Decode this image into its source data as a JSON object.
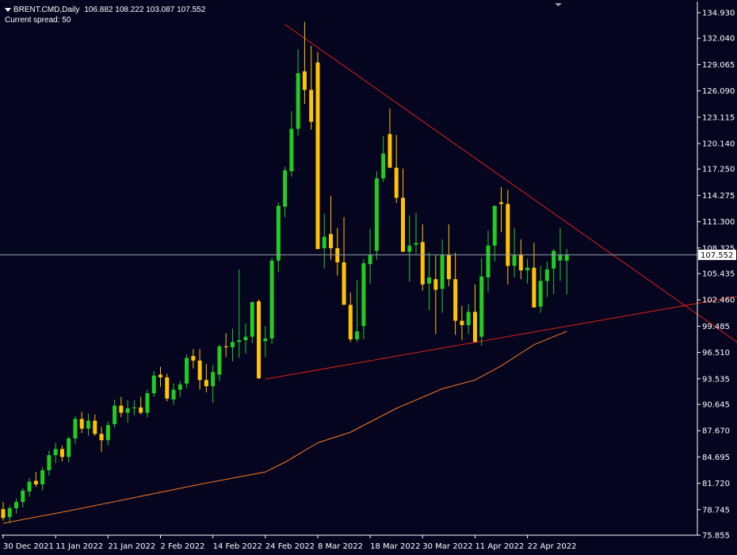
{
  "header": {
    "symbol": "BRENT.CMD,Daily",
    "ohlc": "106.882 108.222 103.087 107.552",
    "spread": "Current spread: 50"
  },
  "colors": {
    "background": "#050520",
    "axis": "#ffffff",
    "bull": "#22cc22",
    "bear": "#ffc400",
    "trendline": "#dd2211",
    "moving_average": "#ff7a1a",
    "price_line": "#9aa0b0",
    "price_tag_bg": "#ffffff",
    "price_tag_text": "#000000"
  },
  "chart_data": {
    "type": "candlestick",
    "title": "",
    "ylim": [
      75.855,
      134.93
    ],
    "y_ticks": [
      "134.930",
      "132.040",
      "129.065",
      "126.090",
      "123.115",
      "120.140",
      "117.250",
      "114.275",
      "111.300",
      "108.325",
      "105.435",
      "102.460",
      "99.485",
      "96.510",
      "93.535",
      "90.645",
      "87.670",
      "84.695",
      "81.720",
      "78.745",
      "75.855"
    ],
    "x_labels": [
      {
        "label": "30 Dec 2021",
        "i": 0
      },
      {
        "label": "11 Jan 2022",
        "i": 8
      },
      {
        "label": "21 Jan 2022",
        "i": 16
      },
      {
        "label": "2 Feb 2022",
        "i": 24
      },
      {
        "label": "14 Feb 2022",
        "i": 32
      },
      {
        "label": "24 Feb 2022",
        "i": 40
      },
      {
        "label": "8 Mar 2022",
        "i": 48
      },
      {
        "label": "18 Mar 2022",
        "i": 56
      },
      {
        "label": "30 Mar 2022",
        "i": 64
      },
      {
        "label": "11 Apr 2022",
        "i": 72
      },
      {
        "label": "22 Apr 2022",
        "i": 80
      }
    ],
    "current_price": 107.552,
    "current_price_label": "107.552",
    "candles": [
      [
        78.8,
        79.6,
        77.5,
        77.8
      ],
      [
        77.9,
        79.2,
        77.2,
        78.9
      ],
      [
        78.9,
        80.0,
        78.3,
        79.6
      ],
      [
        79.6,
        81.2,
        79.0,
        80.9
      ],
      [
        80.8,
        82.3,
        80.2,
        81.9
      ],
      [
        82.0,
        83.0,
        81.3,
        81.6
      ],
      [
        81.6,
        83.6,
        80.9,
        83.2
      ],
      [
        83.2,
        85.4,
        82.6,
        84.9
      ],
      [
        84.9,
        86.3,
        84.0,
        85.6
      ],
      [
        85.6,
        86.0,
        84.2,
        84.7
      ],
      [
        84.7,
        87.0,
        84.1,
        86.8
      ],
      [
        86.8,
        89.3,
        86.2,
        89.0
      ],
      [
        89.0,
        89.8,
        87.4,
        87.9
      ],
      [
        87.9,
        89.6,
        87.1,
        88.8
      ],
      [
        88.8,
        89.5,
        87.1,
        87.3
      ],
      [
        87.3,
        88.1,
        85.3,
        86.6
      ],
      [
        86.6,
        88.7,
        86.0,
        88.3
      ],
      [
        88.4,
        91.2,
        88.0,
        90.5
      ],
      [
        90.5,
        91.5,
        89.2,
        89.7
      ],
      [
        89.7,
        91.1,
        88.6,
        90.2
      ],
      [
        90.2,
        91.1,
        89.4,
        90.3
      ],
      [
        90.3,
        91.5,
        89.5,
        89.7
      ],
      [
        89.7,
        92.3,
        89.2,
        91.9
      ],
      [
        91.9,
        94.4,
        91.5,
        93.9
      ],
      [
        94.0,
        94.9,
        92.6,
        93.7
      ],
      [
        93.7,
        94.1,
        91.0,
        91.3
      ],
      [
        91.2,
        93.0,
        90.6,
        92.3
      ],
      [
        92.3,
        93.3,
        91.5,
        92.9
      ],
      [
        93.0,
        96.3,
        92.5,
        95.9
      ],
      [
        96.1,
        96.9,
        94.7,
        95.6
      ],
      [
        95.6,
        96.9,
        92.3,
        93.4
      ],
      [
        93.4,
        95.2,
        92.0,
        92.7
      ],
      [
        92.7,
        95.1,
        90.8,
        94.3
      ],
      [
        94.0,
        97.4,
        93.3,
        97.2
      ],
      [
        97.2,
        98.7,
        96.0,
        97.1
      ],
      [
        97.1,
        99.2,
        95.5,
        97.7
      ],
      [
        97.7,
        105.9,
        95.9,
        97.9
      ],
      [
        97.9,
        99.8,
        96.4,
        98.3
      ],
      [
        98.3,
        102.3,
        97.6,
        102.2
      ],
      [
        102.3,
        102.5,
        93.5,
        93.6
      ],
      [
        97.8,
        99.5,
        96.0,
        98.1
      ],
      [
        98.1,
        107.2,
        97.5,
        106.9
      ],
      [
        106.9,
        113.5,
        105.6,
        113.1
      ],
      [
        113.0,
        117.5,
        111.8,
        117.1
      ],
      [
        117.0,
        123.8,
        116.4,
        121.8
      ],
      [
        121.8,
        130.8,
        121.0,
        128.1
      ],
      [
        128.3,
        133.9,
        124.6,
        126.2
      ],
      [
        126.2,
        131.2,
        121.7,
        122.6
      ],
      [
        129.3,
        130.5,
        108.3,
        108.2
      ],
      [
        108.3,
        112.2,
        106.0,
        109.6
      ],
      [
        109.9,
        114.2,
        107.0,
        108.3
      ],
      [
        108.3,
        110.6,
        105.2,
        106.7
      ],
      [
        106.7,
        111.8,
        101.9,
        101.9
      ],
      [
        101.9,
        103.3,
        97.7,
        98.0
      ],
      [
        98.0,
        104.7,
        97.7,
        98.9
      ],
      [
        99.5,
        107.1,
        98.0,
        106.6
      ],
      [
        106.5,
        110.5,
        104.3,
        107.5
      ],
      [
        108.0,
        117.0,
        107.0,
        116.2
      ],
      [
        116.2,
        121.0,
        115.8,
        119.0
      ],
      [
        121.2,
        124.1,
        117.7,
        117.4
      ],
      [
        117.4,
        121.1,
        113.4,
        114.0
      ],
      [
        114.0,
        117.3,
        109.0,
        107.9
      ],
      [
        107.9,
        112.0,
        104.5,
        108.6
      ],
      [
        108.7,
        112.3,
        107.7,
        108.9
      ],
      [
        109.0,
        111.0,
        103.5,
        104.2
      ],
      [
        104.3,
        107.8,
        101.3,
        105.0
      ],
      [
        104.8,
        107.5,
        98.6,
        103.6
      ],
      [
        103.7,
        109.3,
        101.0,
        107.5
      ],
      [
        107.5,
        111.0,
        104.0,
        104.8
      ],
      [
        104.8,
        107.8,
        98.5,
        100.1
      ],
      [
        100.1,
        101.8,
        97.9,
        99.6
      ],
      [
        99.6,
        102.0,
        98.6,
        101.1
      ],
      [
        101.1,
        104.2,
        98.2,
        97.7
      ],
      [
        98.3,
        107.2,
        97.3,
        105.1
      ],
      [
        105.0,
        110.3,
        103.3,
        108.6
      ],
      [
        108.6,
        111.8,
        106.8,
        113.1
      ],
      [
        113.5,
        115.2,
        110.1,
        113.3
      ],
      [
        113.3,
        114.9,
        104.2,
        106.3
      ],
      [
        106.3,
        110.6,
        105.0,
        107.5
      ],
      [
        107.6,
        109.3,
        104.8,
        105.8
      ],
      [
        105.8,
        107.1,
        104.3,
        106.1
      ],
      [
        106.1,
        108.9,
        101.9,
        101.6
      ],
      [
        101.7,
        106.3,
        101.0,
        104.6
      ],
      [
        104.6,
        106.8,
        102.8,
        105.9
      ],
      [
        106.0,
        108.2,
        103.1,
        108.0
      ],
      [
        106.9,
        110.6,
        104.6,
        107.5
      ],
      [
        106.882,
        108.222,
        103.087,
        107.552
      ]
    ],
    "moving_average": [
      [
        0,
        77.2
      ],
      [
        10,
        78.6
      ],
      [
        20,
        80.1
      ],
      [
        30,
        81.6
      ],
      [
        40,
        83.0
      ],
      [
        43,
        84.1
      ],
      [
        48,
        86.3
      ],
      [
        53,
        87.5
      ],
      [
        60,
        90.2
      ],
      [
        67,
        92.4
      ],
      [
        72,
        93.4
      ],
      [
        76,
        95.0
      ],
      [
        81,
        97.4
      ],
      [
        85,
        98.6
      ],
      [
        86,
        98.9
      ]
    ],
    "trendlines": [
      {
        "from": [
          43,
          133.6
        ],
        "to": [
          120,
          93.5
        ]
      },
      {
        "from": [
          40,
          93.5
        ],
        "to": [
          120,
          103.9
        ]
      }
    ]
  }
}
